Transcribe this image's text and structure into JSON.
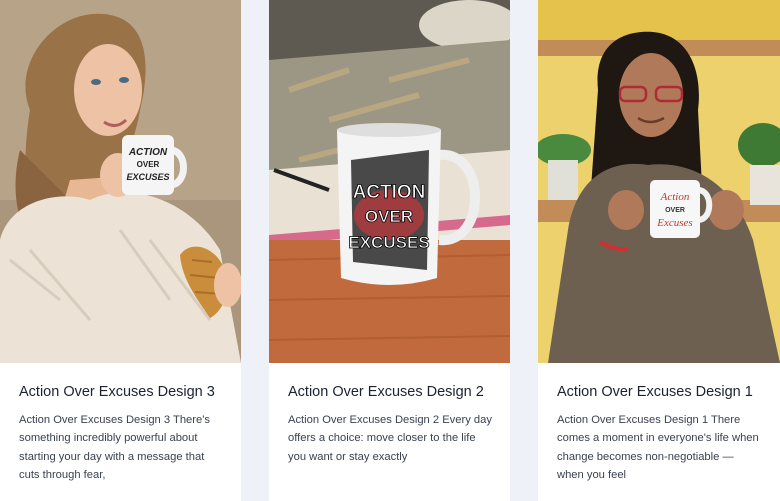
{
  "cards": [
    {
      "title": "Action Over Excuses Design 3",
      "description": "Action Over Excuses Design 3 There's something incredibly powerful about starting your day with a message that cuts through fear,",
      "mug_text": [
        "ACTION",
        "OVER",
        "EXCUSES"
      ]
    },
    {
      "title": "Action Over Excuses Design 2",
      "description": "Action Over Excuses Design 2 Every day offers a choice: move closer to the life you want or stay exactly",
      "mug_text": [
        "ACTION",
        "OVER",
        "EXCUSES"
      ]
    },
    {
      "title": "Action Over Excuses Design 1",
      "description": "Action Over Excuses Design 1 There comes a moment in everyone's life when change becomes non-negotiable — when you feel",
      "mug_text": [
        "Action",
        "OVER",
        "Excuses"
      ]
    }
  ],
  "colors": {
    "page_bg": "#eef2f8",
    "card_bg": "#ffffff",
    "title": "#1c2230",
    "body_text": "#3a4150"
  }
}
